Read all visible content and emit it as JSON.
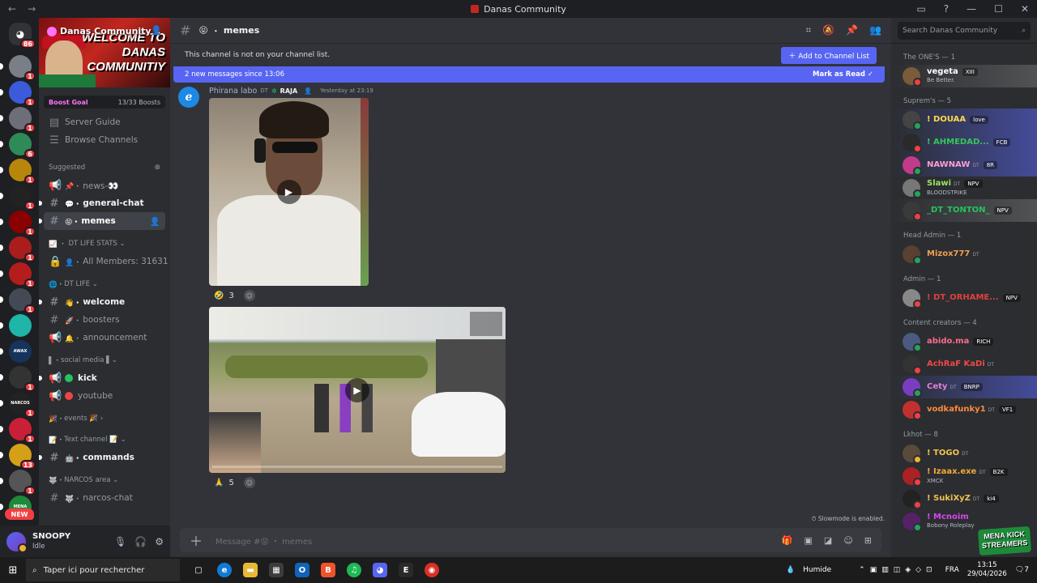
{
  "window": {
    "title": "Danas Community",
    "back": "←",
    "forward": "→",
    "controls": [
      "▭",
      "?",
      "—",
      "☐",
      "✕"
    ]
  },
  "servers": {
    "home_badge": "86",
    "items": [
      {
        "color": "#7a7f87",
        "badge": "1",
        "label": ""
      },
      {
        "color": "#3b5bdb",
        "badge": "1",
        "label": ""
      },
      {
        "color": "#6d6f78",
        "badge": "1",
        "label": ""
      },
      {
        "color": "#2e8b57",
        "badge": "6",
        "label": ""
      },
      {
        "color": "#b8860b",
        "badge": "1",
        "label": ""
      },
      {
        "color": "#222222",
        "badge": "1",
        "label": ""
      },
      {
        "color": "#8b0000",
        "badge": "1",
        "label": ""
      },
      {
        "color": "#aa1d1d",
        "badge": "1",
        "label": ""
      },
      {
        "color": "#b51c1c",
        "badge": "1",
        "label": ""
      },
      {
        "color": "#444a55",
        "badge": "1",
        "label": ""
      },
      {
        "color": "#1fb5a8",
        "badge": "",
        "label": ""
      },
      {
        "color": "#15345c",
        "badge": "",
        "label": "AWAX"
      },
      {
        "color": "#333333",
        "badge": "1",
        "label": ""
      },
      {
        "color": "#222222",
        "badge": "1",
        "label": "NARCOS"
      },
      {
        "color": "#c91f37",
        "badge": "1",
        "label": ""
      },
      {
        "color": "#d4a017",
        "badge": "13",
        "label": ""
      },
      {
        "color": "#555555",
        "badge": "1",
        "label": ""
      },
      {
        "color": "#1d8a3a",
        "badge": "1",
        "label": "MENA"
      }
    ],
    "new_label": "NEW"
  },
  "server": {
    "name": "Danas Community",
    "banner_text": "WELCOME TO DANAS COMMUNITIY",
    "boost_label": "Boost Goal",
    "boost_value": "13/33 Boosts",
    "nav": [
      "Server Guide",
      "Browse Channels"
    ],
    "suggested_label": "Suggested"
  },
  "channels": {
    "suggested": [
      {
        "icon": "📢",
        "name": "news-👀",
        "unread": false,
        "emoji": "📌"
      },
      {
        "icon": "#",
        "name": "general-chat",
        "unread": true,
        "emoji": "💬"
      },
      {
        "icon": "#",
        "name": "memes",
        "unread": true,
        "emoji": "😝",
        "selected": true
      }
    ],
    "cat_stats": "DT LIFE STATS",
    "all_members": "All Members: 31631",
    "cat_life": "DT LIFE",
    "life": [
      {
        "icon": "#",
        "name": "welcome",
        "unread": true,
        "emoji": "👋"
      },
      {
        "icon": "#",
        "name": "boosters",
        "unread": false,
        "emoji": "🚀"
      },
      {
        "icon": "📢",
        "name": "announcement",
        "unread": false,
        "emoji": "🔔"
      }
    ],
    "cat_social": "social media",
    "social": [
      {
        "name": "kick",
        "color": "#22c55e",
        "unread": true
      },
      {
        "name": "youtube",
        "color": "#ef4444",
        "unread": false
      }
    ],
    "cat_events": "events",
    "cat_text": "Text channel",
    "commands": "commands",
    "cat_narcos": "NARCOS area",
    "narcos_chat": "narcos-chat"
  },
  "user": {
    "name": "SNOOPY",
    "status": "Idle"
  },
  "header": {
    "channel": "memes",
    "emoji": "😝"
  },
  "notice": {
    "text": "This channel is not on your channel list.",
    "button": "Add to Channel List"
  },
  "newmsgs": {
    "text": "2 new messages since 13:06",
    "mark": "Mark as Read"
  },
  "message": {
    "author": "Phirana labo",
    "tag": "DT",
    "role": "RAJA",
    "time": "Yesterday at 23:19",
    "reactions": [
      {
        "emoji": "🤣",
        "count": "3"
      },
      {
        "emoji": "🙏",
        "count": "5"
      }
    ]
  },
  "slowmode": "Slowmode is enabled.",
  "composer": {
    "placeholder": "Message #😝 ・ memes"
  },
  "members": {
    "search_placeholder": "Search Danas Community",
    "groups": [
      {
        "title": "The ONE'S — 1",
        "members": [
          {
            "name": "vegeta",
            "pill": "XIII",
            "sub": "Be Better.",
            "color": "#ffffff",
            "av": "#7a5c3a",
            "hl": "hl2",
            "status": "#f23f43"
          }
        ]
      },
      {
        "title": "Suprem's — 5",
        "members": [
          {
            "name": "! DOUAA",
            "pill": "love",
            "color": "#ffd84d",
            "av": "#444",
            "hl": "hl",
            "status": "#23a55a"
          },
          {
            "name": "! AHMEDAD...",
            "pill": "FCB",
            "color": "#34c759",
            "av": "#2a2a2a",
            "hl": "hl",
            "status": "#f23f43"
          },
          {
            "name": "NAWNAW",
            "tag": "DT",
            "pill": "8R",
            "color": "#ff9ecf",
            "av": "#c23b8b",
            "hl": "hl",
            "status": "#23a55a"
          },
          {
            "name": "Slawi",
            "tag": "DT",
            "pill": "NPV",
            "sub": "BLOODSTRIKE",
            "color": "#9be564",
            "av": "#777",
            "hl": "",
            "status": "#23a55a"
          },
          {
            "name": "_DT_TONTON_",
            "pill": "NPV",
            "color": "#22c55e",
            "av": "#3a3a3a",
            "hl": "hl2",
            "status": "#f23f43"
          }
        ]
      },
      {
        "title": "Head Admin — 1",
        "members": [
          {
            "name": "Mizox777",
            "tag": "DT",
            "color": "#f0a050",
            "av": "#5a4030",
            "hl": "",
            "status": "#23a55a"
          }
        ]
      },
      {
        "title": "Admin — 1",
        "members": [
          {
            "name": "! DT_ORHAME...",
            "pill": "NPV",
            "color": "#e04040",
            "av": "#888",
            "hl": "",
            "status": "#f23f43"
          }
        ]
      },
      {
        "title": "Content creators — 4",
        "members": [
          {
            "name": "abido.ma",
            "pill": "RICH",
            "color": "#ff6b8b",
            "av": "#4a5a80",
            "hl": "",
            "status": "#23a55a"
          },
          {
            "name": "AchRaF KaDi",
            "tag": "DT",
            "color": "#f04747",
            "av": "#333",
            "hl": "",
            "status": "#f23f43"
          },
          {
            "name": "Cety",
            "tag": "DT",
            "pill": "BNRP",
            "color": "#e67ed1",
            "av": "#7a3dbf",
            "hl": "hl",
            "status": "#23a55a"
          },
          {
            "name": "vodkafunky1",
            "tag": "DT",
            "pill": "VF1",
            "color": "#ff8a3d",
            "av": "#c23030",
            "hl": "",
            "status": "#f23f43"
          }
        ]
      },
      {
        "title": "Lkhot — 8",
        "members": [
          {
            "name": "! TOGO",
            "tag": "DT",
            "color": "#f2c14e",
            "av": "#5a4a3a",
            "hl": "",
            "status": "#f0b232"
          },
          {
            "name": "! Izaax.exe",
            "tag": "DT",
            "pill": "B2K",
            "sub": "XMCK",
            "color": "#f2a93b",
            "av": "#aa2222",
            "hl": "",
            "status": "#f23f43"
          },
          {
            "name": "! SukiXyZ",
            "tag": "DT",
            "pill": "ki4",
            "color": "#f2c14e",
            "av": "#222",
            "hl": "",
            "status": "#f23f43"
          },
          {
            "name": "! Mcnoim",
            "sub": "Bobony Roleplay",
            "color": "#d946ef",
            "av": "#552266",
            "hl": "",
            "status": "#23a55a"
          }
        ]
      }
    ]
  },
  "taskbar": {
    "search": "Taper ici pour rechercher",
    "weather": "Humide",
    "lang": "FRA",
    "time": "13:15",
    "date": "29/04/2026",
    "notif": "7"
  },
  "overlay": "MENA KICK STREAMERS"
}
